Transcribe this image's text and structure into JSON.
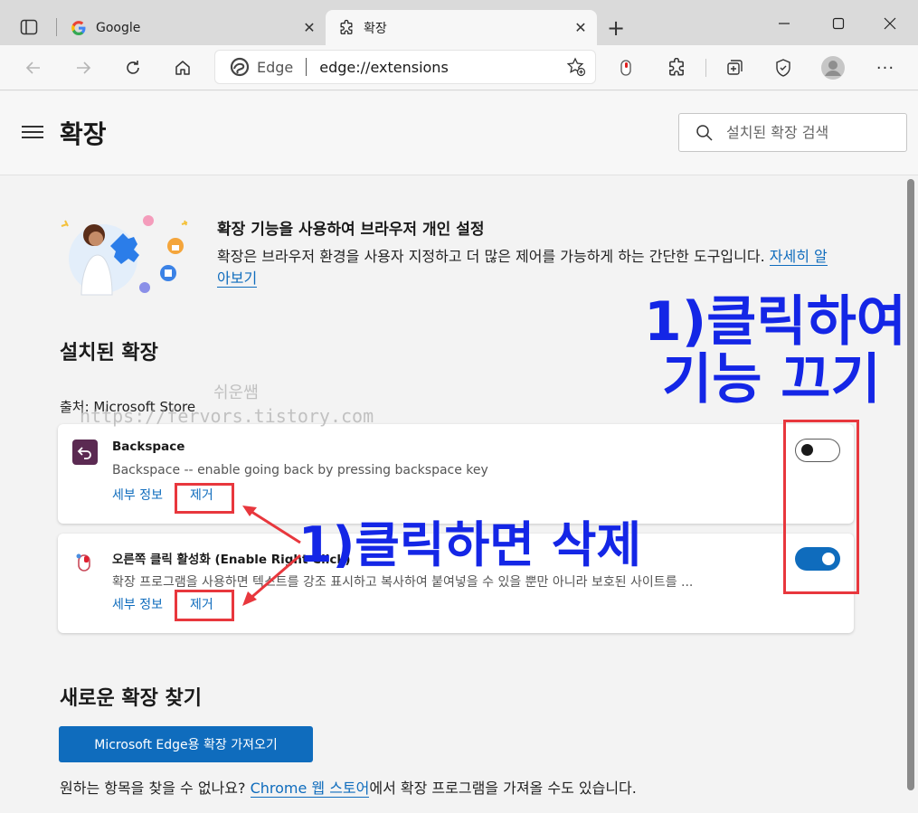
{
  "browser": {
    "tabs": [
      {
        "title": "Google",
        "icon": "google-icon",
        "active": false
      },
      {
        "title": "확장",
        "icon": "extensions-icon",
        "active": true
      }
    ],
    "address": {
      "site_name": "Edge",
      "url": "edge://extensions"
    }
  },
  "header": {
    "title": "확장",
    "search_placeholder": "설치된 확장 검색"
  },
  "banner": {
    "title": "확장 기능을 사용하여 브라우저 개인 설정",
    "description": "확장은 브라우저 환경을 사용자 지정하고 더 많은 제어를 가능하게 하는 간단한 도구입니다.",
    "learn_more": "자세히 알아보기"
  },
  "installed": {
    "title": "설치된 확장",
    "source": "출처: Microsoft Store",
    "extensions": [
      {
        "name": "Backspace",
        "description": "Backspace -- enable going back by pressing backspace key",
        "details_label": "세부 정보",
        "remove_label": "제거",
        "enabled": false
      },
      {
        "name": "오른쪽 클릭 활성화 (Enable Right Click)",
        "description": "확장 프로그램을 사용하면 텍스트를 강조 표시하고 복사하여 붙여넣을 수 있을 뿐만 아니라 보호된 사이트를 ...",
        "details_label": "세부 정보",
        "remove_label": "제거",
        "enabled": true
      }
    ]
  },
  "find_new": {
    "title": "새로운 확장 찾기",
    "button_label": "Microsoft Edge용 확장 가져오기",
    "text_before": "원하는 항목을 찾을 수 없나요? ",
    "store_link": "Chrome 웹 스토어",
    "text_after": "에서 확장 프로그램을 가져올 수도 있습니다."
  },
  "annotations": {
    "toggle_note_line1": "1)클릭하여",
    "toggle_note_line2": "기능 끄기",
    "remove_note": "1)클릭하면 삭제",
    "watermark_line1": "쉬운쌤",
    "watermark_line2": "https://fervors.tistory.com",
    "color_box": "#e8373d",
    "color_text": "#1426e6"
  },
  "colors": {
    "accent": "#0f6cbd"
  }
}
